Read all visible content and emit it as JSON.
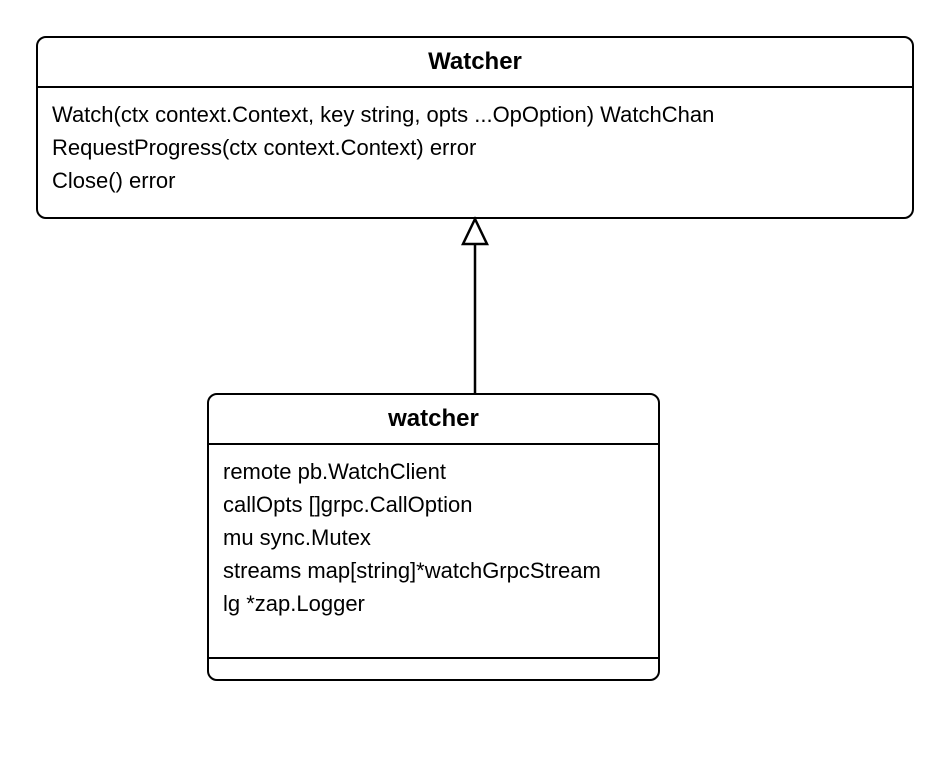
{
  "interface": {
    "name": "Watcher",
    "methods": [
      "Watch(ctx context.Context, key string, opts ...OpOption) WatchChan",
      "RequestProgress(ctx context.Context) error",
      "Close() error"
    ]
  },
  "class": {
    "name": "watcher",
    "fields": [
      "remote   pb.WatchClient",
      "callOpts []grpc.CallOption",
      "mu sync.Mutex",
      "streams map[string]*watchGrpcStream",
      "lg      *zap.Logger"
    ]
  }
}
